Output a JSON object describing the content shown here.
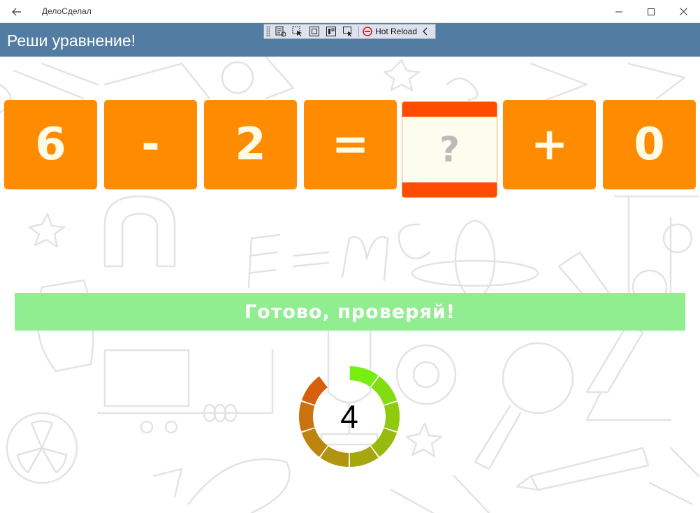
{
  "window": {
    "app_title": "ДелоСделал"
  },
  "header": {
    "title": "Реши уравнение!"
  },
  "debug_toolbar": {
    "hot_reload_label": "Hot Reload"
  },
  "equation": {
    "tiles": [
      "6",
      "-",
      "2",
      "=",
      "+",
      "0"
    ],
    "answer_placeholder": "?"
  },
  "check_button": {
    "label": "Готово, проверяй!"
  },
  "timer": {
    "value": "4",
    "segments_total": 10,
    "segments_filled": 9
  },
  "colors": {
    "header_bg": "#537ca3",
    "tile_bg": "#ff8c00",
    "answer_accent": "#ff4c00",
    "check_button_bg": "#90ee90"
  }
}
